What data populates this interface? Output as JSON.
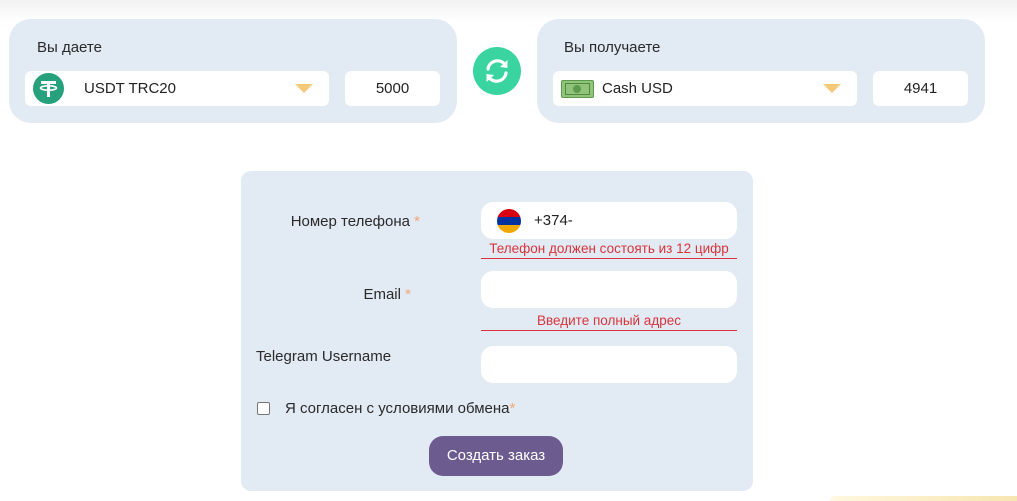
{
  "exchange": {
    "give": {
      "title": "Вы даете",
      "currency": "USDT TRC20",
      "currency_icon": "tether-icon",
      "amount": "5000"
    },
    "receive": {
      "title": "Вы получаете",
      "currency": "Cash USD",
      "currency_icon": "cash-banknote-icon",
      "amount": "4941"
    },
    "swap_icon": "swap-arrows-icon"
  },
  "form": {
    "phone": {
      "label": "Номер телефона",
      "required_mark": "*",
      "country_flag": "armenia-flag-icon",
      "value": "+374-",
      "error": "Телефон должен состоять из 12 цифр"
    },
    "email": {
      "label": "Email",
      "required_mark": "*",
      "value": "",
      "error": "Введите полный адрес"
    },
    "telegram": {
      "label": "Telegram Username",
      "value": ""
    },
    "agreement": {
      "label": "Я согласен с условиями обмена",
      "required_mark": "*",
      "checked": false
    },
    "submit_label": "Создать заказ"
  },
  "colors": {
    "panel_bg": "#e2eaf4",
    "accent_green": "#3ad4a0",
    "tether_green": "#26a17b",
    "dropdown_arrow": "#f6c879",
    "required_mark": "#f3a872",
    "error": "#d9343b",
    "submit_bg": "#6c5b8f"
  }
}
